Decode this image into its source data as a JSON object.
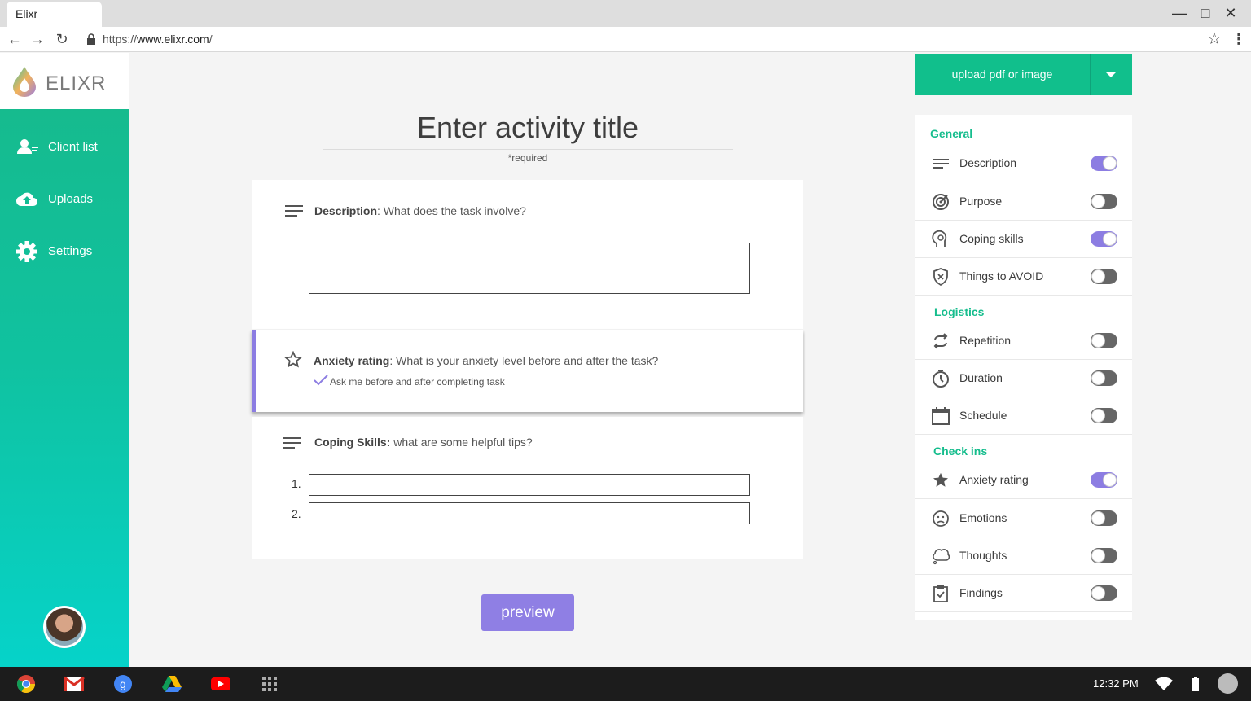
{
  "browser": {
    "tab_title": "Elixr",
    "url_prefix": "https://",
    "url_host": "www.elixr.com",
    "url_suffix": "/"
  },
  "sidebar": {
    "logo_text": "ELIXR",
    "items": [
      {
        "label": "Client list",
        "icon": "users-icon"
      },
      {
        "label": "Uploads",
        "icon": "cloud-upload-icon"
      },
      {
        "label": "Settings",
        "icon": "gear-icon"
      }
    ]
  },
  "main": {
    "title_placeholder": "Enter activity title",
    "required_note": "*required",
    "description": {
      "label": "Description",
      "prompt": ": What does the task involve?"
    },
    "anxiety": {
      "label": "Anxiety rating",
      "prompt": ": What is your anxiety level before and after the task?",
      "check_text": "Ask me before and after completing task"
    },
    "coping": {
      "label": "Coping Skills:",
      "prompt": " what are some helpful tips?",
      "numbers": [
        "1.",
        "2."
      ]
    },
    "preview_label": "preview"
  },
  "upload": {
    "label": "upload pdf or image"
  },
  "panel": {
    "sections": [
      {
        "title": "General",
        "items": [
          {
            "label": "Description",
            "icon": "lines-icon",
            "on": true
          },
          {
            "label": "Purpose",
            "icon": "target-icon",
            "on": false
          },
          {
            "label": "Coping skills",
            "icon": "head-icon",
            "on": true
          },
          {
            "label": "Things to AVOID",
            "icon": "shield-x-icon",
            "on": false
          }
        ]
      },
      {
        "title": "Logistics",
        "items": [
          {
            "label": "Repetition",
            "icon": "repeat-icon",
            "on": false
          },
          {
            "label": "Duration",
            "icon": "timer-icon",
            "on": false
          },
          {
            "label": "Schedule",
            "icon": "calendar-icon",
            "on": false
          }
        ]
      },
      {
        "title": "Check ins",
        "items": [
          {
            "label": "Anxiety rating",
            "icon": "star-icon",
            "on": true
          },
          {
            "label": "Emotions",
            "icon": "sad-face-icon",
            "on": false
          },
          {
            "label": "Thoughts",
            "icon": "thought-bubble-icon",
            "on": false
          },
          {
            "label": "Findings",
            "icon": "clipboard-check-icon",
            "on": false
          }
        ]
      }
    ]
  },
  "taskbar": {
    "time": "12:32 PM"
  },
  "colors": {
    "accent_green": "#11bf8c",
    "accent_purple": "#8c7de2"
  }
}
